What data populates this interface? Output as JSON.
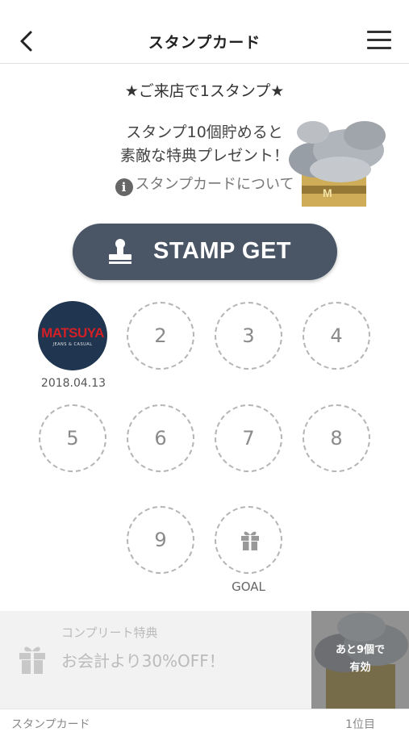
{
  "header": {
    "title": "スタンプカード",
    "back_icon": "chevron-left-icon",
    "menu_icon": "hamburger-menu-icon"
  },
  "info": {
    "lead": "★ご来店で1スタンプ★",
    "desc_line1": "スタンプ10個貯めると",
    "desc_line2": "素敵な特典プレゼント！",
    "about_link": "スタンプカードについて"
  },
  "stamp_button": {
    "label": "STAMP GET",
    "icon": "stamp-icon"
  },
  "stamps": {
    "first": {
      "logo": "MATSUYA",
      "logo_sub": "JEANS & CASUAL",
      "date": "2018.04.13"
    },
    "slots": [
      "2",
      "3",
      "4",
      "5",
      "6",
      "7",
      "8",
      "9"
    ],
    "goal_label": "GOAL"
  },
  "reward": {
    "kicker": "コンプリート特典",
    "text": "お会計より30%OFF！",
    "badge_line1": "あと9個で",
    "badge_line2": "有効"
  },
  "footer": {
    "left": "スタンプカード",
    "right": "1位目"
  },
  "colors": {
    "button": "#4a5666",
    "logo_bg": "#1f3550",
    "logo_text": "#d32027"
  }
}
